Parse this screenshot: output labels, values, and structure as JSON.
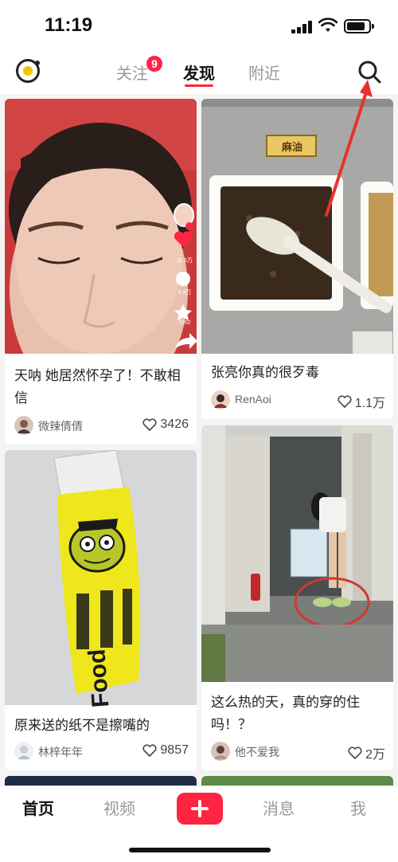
{
  "status_bar": {
    "time": "11:19"
  },
  "top_nav": {
    "tabs": [
      {
        "label": "关注",
        "badge": "9"
      },
      {
        "label": "发现",
        "active": true
      },
      {
        "label": "附近"
      }
    ],
    "colors": {
      "accent": "#ff2442",
      "logo_fill": "#f5c400"
    },
    "icons": {
      "logo": "logo-icon",
      "search": "search-icon"
    }
  },
  "feed": {
    "cards": [
      {
        "title": "天呐 她居然怀孕了！不敢相信",
        "author": "微辣倩倩",
        "likes": "3426"
      },
      {
        "title": "张亮你真的很歹毒",
        "author": "RenAoi",
        "likes": "1.1万"
      },
      {
        "title": "原来送的纸不是擦嘴的",
        "author": "林梓年年",
        "likes": "9857"
      },
      {
        "title": "这么热的天，真的穿的住吗！？",
        "author": "他不爱我",
        "likes": "2万"
      }
    ],
    "card1_overlay": {
      "likes": "11.5万",
      "comments": "2.4万",
      "stars": "1992"
    },
    "card2_image_label": "麻油",
    "card3_image_text": "Food"
  },
  "bottom_bar": {
    "tabs": [
      {
        "label": "首页",
        "active": true
      },
      {
        "label": "视频"
      },
      {
        "label": "消息"
      },
      {
        "label": "我"
      }
    ],
    "create_icon": "plus-icon"
  }
}
